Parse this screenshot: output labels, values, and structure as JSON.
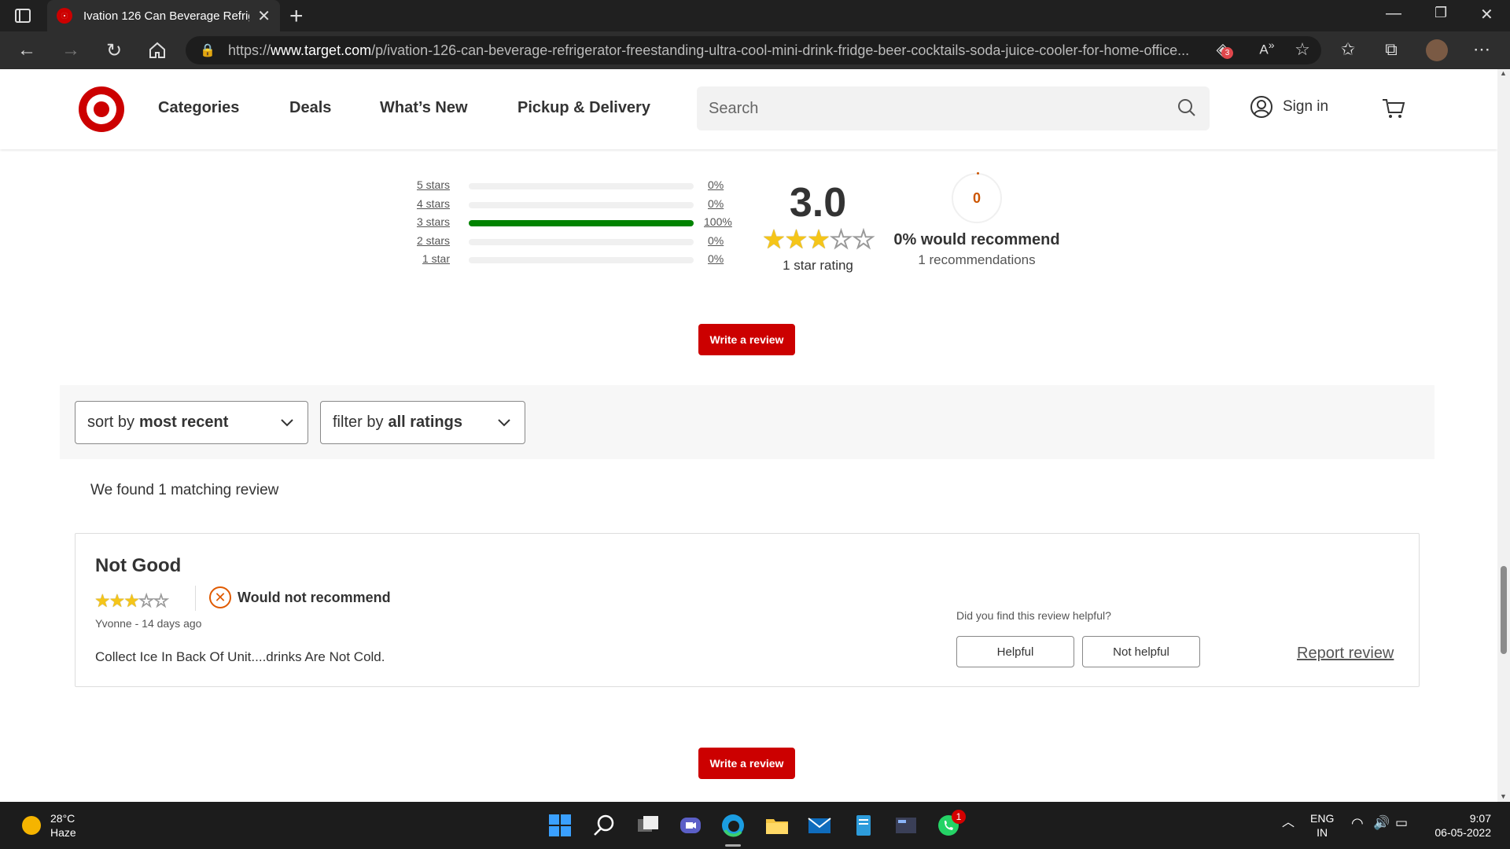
{
  "browser": {
    "tab_title": "Ivation 126 Can Beverage Refrige",
    "url_scheme": "https://",
    "url_host": "www.target.com",
    "url_path": "/p/ivation-126-can-beverage-refrigerator-freestanding-ultra-cool-mini-drink-fridge-beer-cocktails-soda-juice-cooler-for-home-office...",
    "extension_badge": "3"
  },
  "header": {
    "nav": [
      "Categories",
      "Deals",
      "What’s New",
      "Pickup & Delivery"
    ],
    "search_placeholder": "Search",
    "sign_in": "Sign in"
  },
  "ratings": {
    "histogram": [
      {
        "label": "5 stars",
        "pct_label": "0%",
        "fraction": 0
      },
      {
        "label": "4 stars",
        "pct_label": "0%",
        "fraction": 0
      },
      {
        "label": "3 stars",
        "pct_label": "100%",
        "fraction": 1
      },
      {
        "label": "2 stars",
        "pct_label": "0%",
        "fraction": 0
      },
      {
        "label": "1 star",
        "pct_label": "0%",
        "fraction": 0
      }
    ],
    "average": "3.0",
    "average_stars": 3,
    "rating_count": "1 star rating",
    "recommend_count": "0",
    "recommend_headline": "0% would recommend",
    "recommend_sub": "1 recommendations",
    "write_review": "Write a review"
  },
  "filters": {
    "sort_prefix": "sort by",
    "sort_value": "most recent",
    "filter_prefix": "filter by",
    "filter_value": "all ratings"
  },
  "results_text": "We found 1 matching review",
  "review": {
    "title": "Not Good",
    "stars": 3,
    "recommend": "Would not recommend",
    "author_line": "Yvonne - 14 days ago",
    "body": "Collect Ice In Back Of Unit....drinks Are Not Cold.",
    "helpful_question": "Did you find this review helpful?",
    "helpful": "Helpful",
    "not_helpful": "Not helpful",
    "report": "Report review"
  },
  "taskbar": {
    "temp": "28°C",
    "condition": "Haze",
    "lang_top": "ENG",
    "lang_bottom": "IN",
    "time": "9:07",
    "date": "06-05-2022",
    "whatsapp_badge": "1"
  },
  "colors": {
    "brand_red": "#cc0000",
    "bar_green": "#008300",
    "star_gold": "#f5c518",
    "warning_orange": "#e05a00"
  }
}
